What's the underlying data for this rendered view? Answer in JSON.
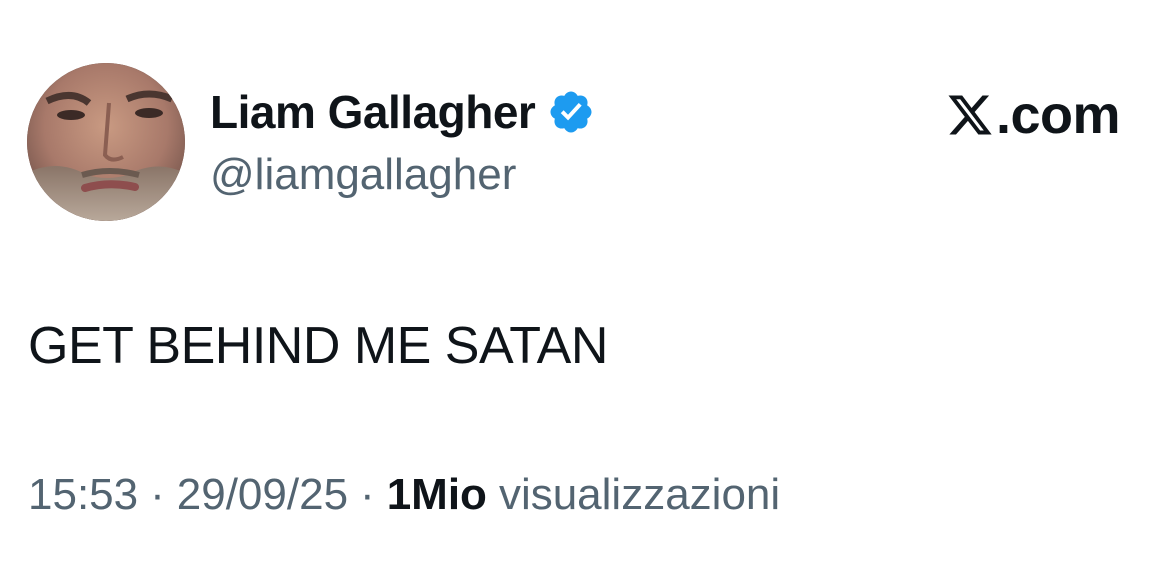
{
  "author": {
    "display_name": "Liam Gallagher",
    "handle": "@liamgallagher",
    "avatar": "profile-photo",
    "verified_icon": "verified-badge-icon",
    "verified_color": "#1d9bf0"
  },
  "brand": {
    "logo_icon": "x-logo-icon",
    "text": ".com"
  },
  "tweet": {
    "text": "GET BEHIND ME SATAN"
  },
  "meta": {
    "time": "15:53",
    "separator": "·",
    "date": "29/09/25",
    "views_count": "1Mio",
    "views_label": "visualizzazioni"
  },
  "colors": {
    "text_primary": "#0f1419",
    "text_secondary": "#536471",
    "background": "#ffffff"
  }
}
